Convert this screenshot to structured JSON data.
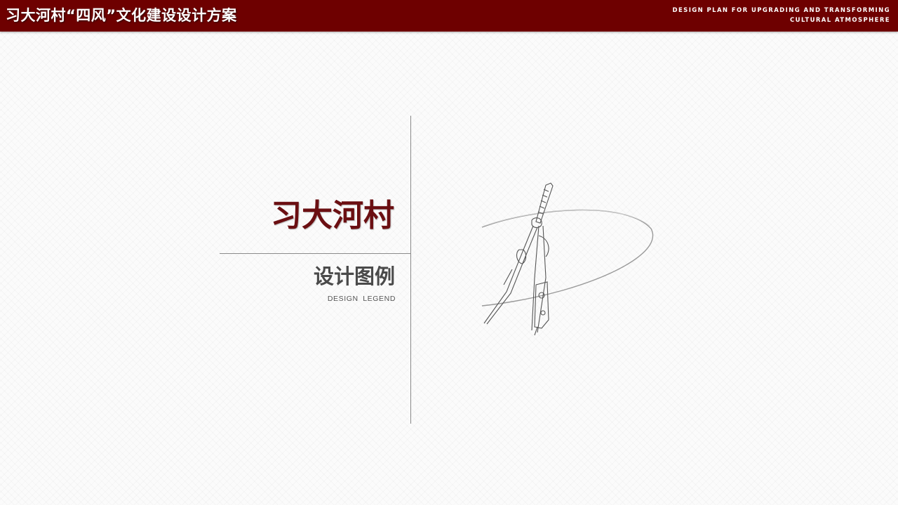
{
  "header": {
    "title": "习大河村“四风”文化建设设计方案",
    "subtitle_line1": "DESIGN PLAN FOR UPGRADING AND TRANSFORMING",
    "subtitle_line2": "CULTURAL ATMOSPHERE",
    "background_color": "#6e0000"
  },
  "section": {
    "title": "习大河村",
    "subtitle": "设计图例",
    "subtitle_en": "DESIGN LEGEND",
    "title_color": "#6b0f12"
  },
  "illustration": {
    "icon": "drafting-compass-icon"
  }
}
